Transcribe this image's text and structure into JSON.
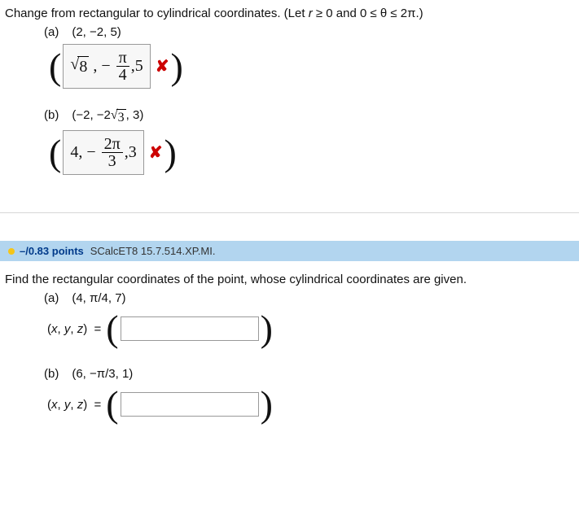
{
  "q1": {
    "prompt": "Change from rectangular to cylindrical coordinates. (Let r ≥ 0 and 0 ≤ θ ≤ 2π.)",
    "parts": {
      "a": {
        "label": "(a)",
        "given": "(2, −2, 5)",
        "answer": "√8 , − π/4 , 5",
        "correct": false
      },
      "b": {
        "label": "(b)",
        "given": "(−2, −2√3, 3)",
        "answer": "4, − 2π/3 , 3",
        "correct": false
      }
    }
  },
  "header": {
    "points": "–/0.83 points",
    "source": "SCalcET8 15.7.514.XP.MI."
  },
  "q2": {
    "prompt": "Find the rectangular coordinates of the point, whose cylindrical coordinates are given.",
    "parts": {
      "a": {
        "label": "(a)",
        "given": "(4, π/4, 7)",
        "lhs": "(x, y, z)  =",
        "answer": ""
      },
      "b": {
        "label": "(b)",
        "given": "(6, −π/3, 1)",
        "lhs": "(x, y, z)  =",
        "answer": ""
      }
    }
  },
  "marks": {
    "wrong": "✘"
  }
}
